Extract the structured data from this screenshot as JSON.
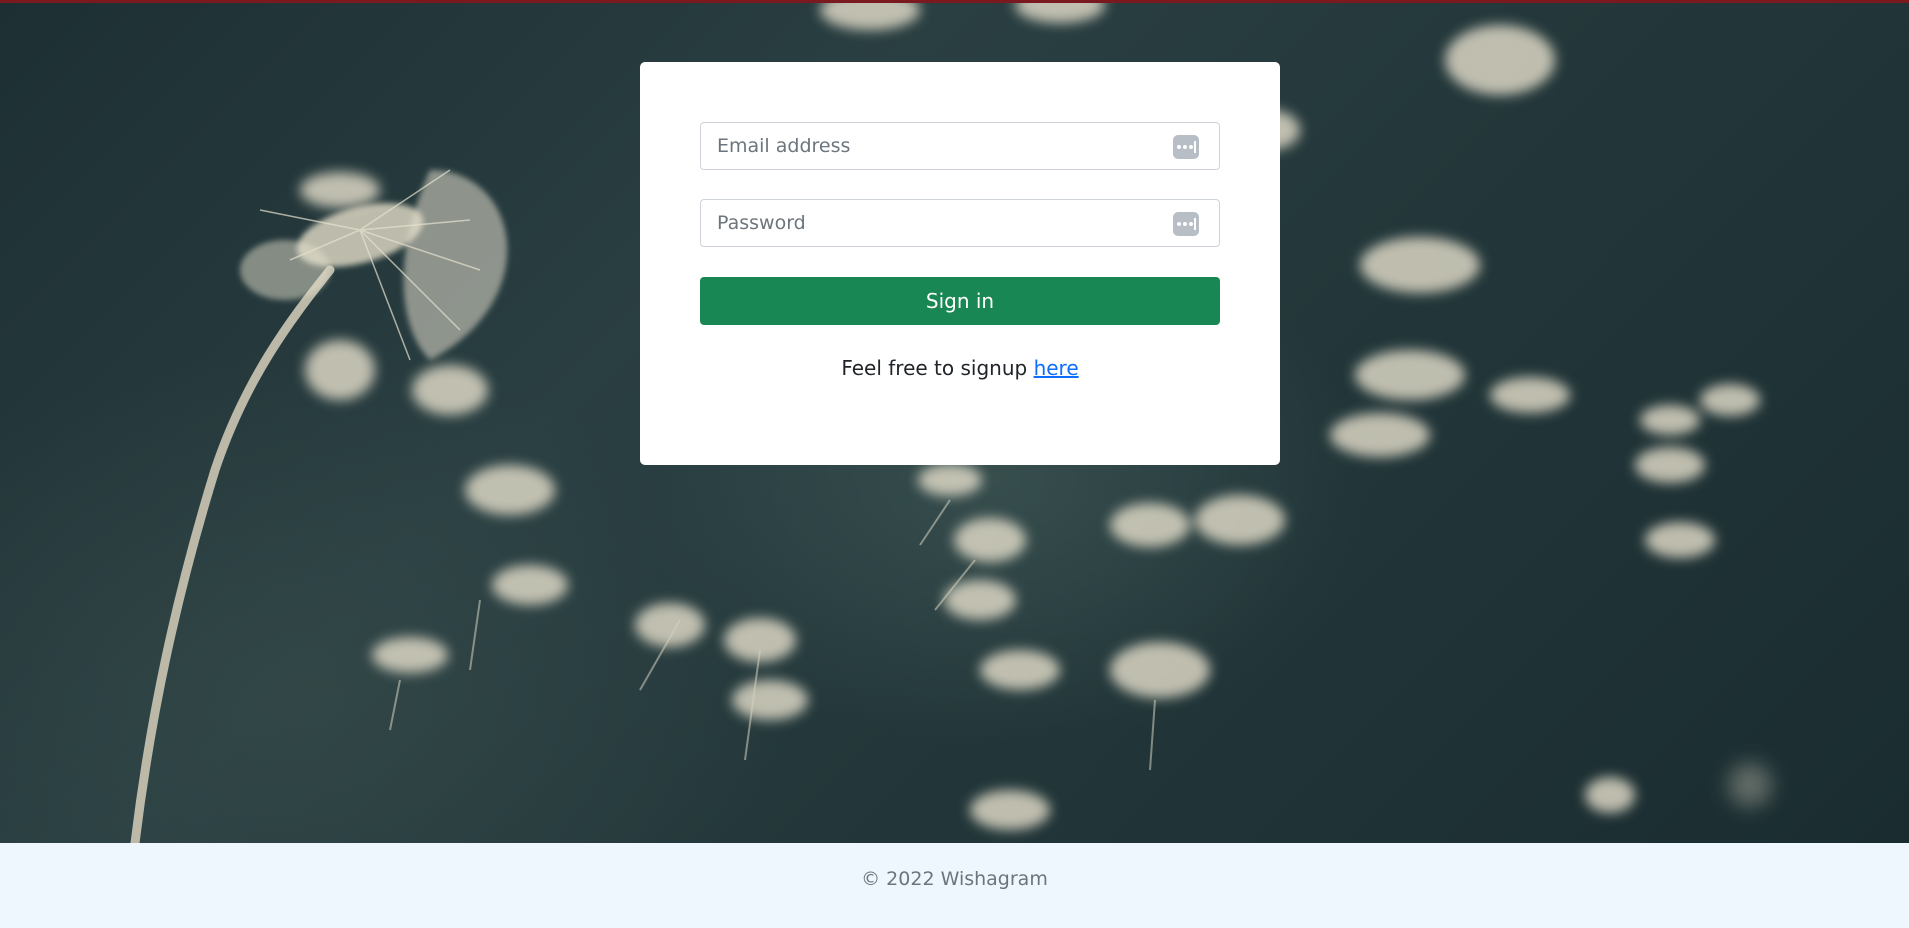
{
  "login_form": {
    "email_placeholder": "Email address",
    "password_placeholder": "Password",
    "submit_label": "Sign in",
    "signup_prompt": "Feel free to signup ",
    "signup_link_label": "here",
    "field_icon": "password-manager-key-icon"
  },
  "footer": {
    "copyright": "© 2022 Wishagram"
  },
  "colors": {
    "primary_button": "#198754",
    "link": "#0d6efd",
    "footer_background": "#eef6fe",
    "hero_background": "#23373a"
  }
}
